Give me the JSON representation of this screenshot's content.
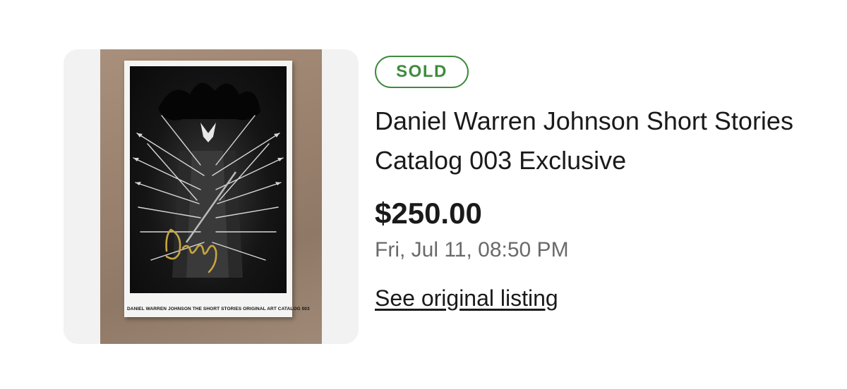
{
  "listing": {
    "status_badge": "SOLD",
    "title": "Daniel Warren Johnson Short Stories Catalog 003 Exclusive",
    "price": "$250.00",
    "sold_date": "Fri, Jul 11, 08:50 PM",
    "link_label": "See original listing"
  },
  "image": {
    "book_cover_text": "DANIEL WARREN JOHNSON THE SHORT STORIES ORIGINAL ART CATALOG 003"
  },
  "colors": {
    "sold_green": "#3d8b3d",
    "text_primary": "#1a1a1a",
    "text_secondary": "#6a6a6a",
    "image_frame_bg": "#f2f2f2"
  }
}
